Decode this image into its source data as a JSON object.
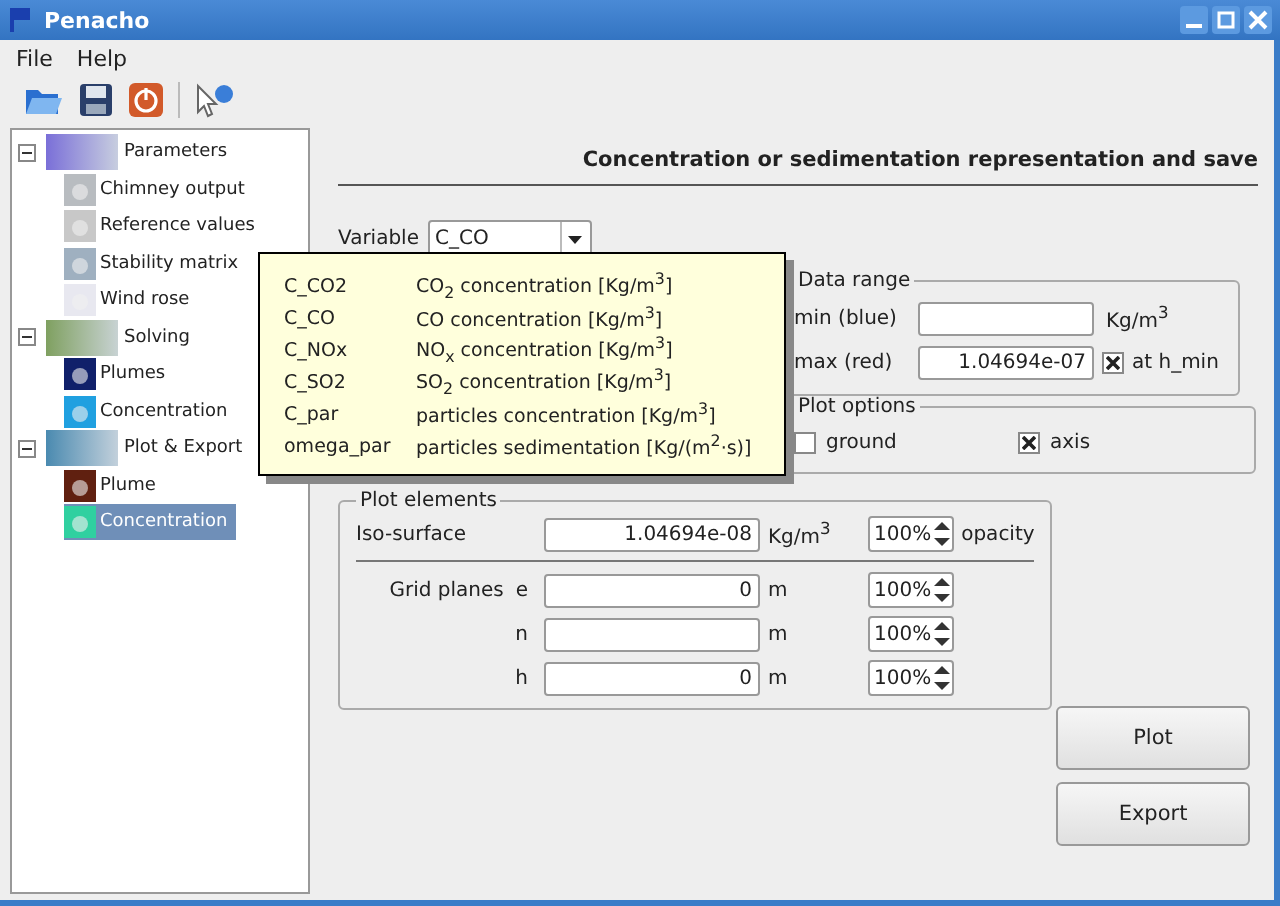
{
  "window": {
    "title": "Penacho"
  },
  "menu": [
    "File",
    "Help"
  ],
  "tree": [
    {
      "label": "Parameters",
      "expanded": true,
      "selected": false,
      "children": [
        {
          "label": "Chimney output",
          "selected": false
        },
        {
          "label": "Reference values",
          "selected": false
        },
        {
          "label": "Stability matrix",
          "selected": false
        },
        {
          "label": "Wind rose",
          "selected": false
        }
      ]
    },
    {
      "label": "Solving",
      "expanded": true,
      "selected": false,
      "children": [
        {
          "label": "Plumes",
          "selected": false
        },
        {
          "label": "Concentration",
          "selected": false
        }
      ]
    },
    {
      "label": "Plot & Export",
      "expanded": true,
      "selected": false,
      "children": [
        {
          "label": "Plume",
          "selected": false
        },
        {
          "label": "Concentration",
          "selected": true
        }
      ]
    }
  ],
  "heading": "Concentration or sedimentation representation and save",
  "variable": {
    "label": "Variable",
    "value": "C_CO"
  },
  "tooltip": [
    {
      "name": "C_CO2",
      "desc": "CO$_{2}$ concentration [Kg/m$^{3}$]"
    },
    {
      "name": "C_CO",
      "desc": "CO concentration [Kg/m$^{3}$]"
    },
    {
      "name": "C_NOx",
      "desc": "NO$_{x}$ concentration [Kg/m$^{3}$]"
    },
    {
      "name": "C_SO2",
      "desc": "SO$_{2}$ concentration [Kg/m$^{3}$]"
    },
    {
      "name": "C_par",
      "desc": "particles concentration [Kg/m$^{3}$]"
    },
    {
      "name": "omega_par",
      "desc": "particles sedimentation [Kg/(m$^{2}$·s)]"
    }
  ],
  "data_range": {
    "title": "Data range",
    "min_label": "min (blue)",
    "min_unit": "Kg/m$^{3}$",
    "max_label": "max (red)",
    "max_value": "1.04694e-07",
    "at_h_min": {
      "label": "at h_min",
      "checked": true
    }
  },
  "plot_options": {
    "title": "Plot options",
    "items": [
      {
        "label": "ground",
        "checked": false
      },
      {
        "label": "axis",
        "checked": true
      }
    ]
  },
  "plot_elements": {
    "title": "Plot elements",
    "iso_label": "Iso-surface",
    "iso_value": "1.04694e-08",
    "iso_unit": "Kg/m$^{3}$",
    "iso_opacity": "100%",
    "opacity_label": "opacity",
    "grid_label": "Grid planes",
    "grid": [
      {
        "axis": "e",
        "value": "0",
        "unit": "m",
        "opacity": "100%"
      },
      {
        "axis": "n",
        "unit": "m",
        "opacity": "100%"
      },
      {
        "axis": "h",
        "value": "0",
        "unit": "m",
        "opacity": "100%"
      }
    ]
  },
  "buttons": [
    "Plot",
    "Export"
  ]
}
